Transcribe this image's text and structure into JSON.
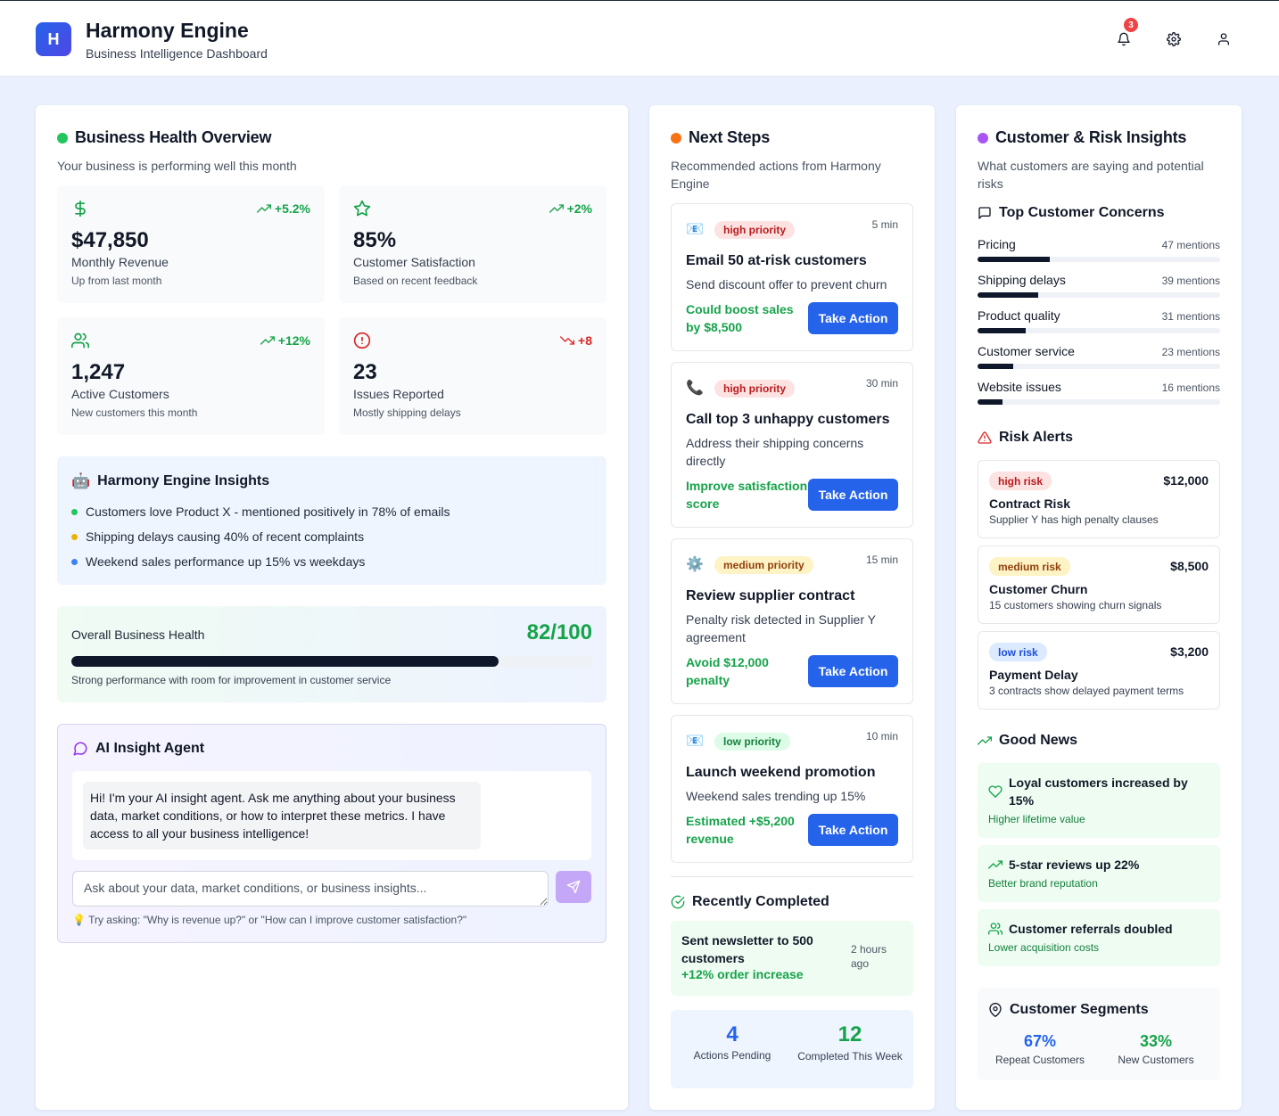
{
  "header": {
    "logo_letter": "H",
    "title": "Harmony Engine",
    "subtitle": "Business Intelligence Dashboard",
    "notification_count": "3",
    "icons": [
      "bell-icon",
      "gear-icon",
      "user-icon"
    ]
  },
  "health_overview": {
    "title": "Business Health Overview",
    "subtitle": "Your business is performing well this month",
    "metrics": [
      {
        "icon": "dollar-icon",
        "change": "+5.2%",
        "trend": "up",
        "value": "$47,850",
        "label": "Monthly Revenue",
        "note": "Up from last month"
      },
      {
        "icon": "star-icon",
        "change": "+2%",
        "trend": "up",
        "value": "85%",
        "label": "Customer Satisfaction",
        "note": "Based on recent feedback"
      },
      {
        "icon": "users-icon",
        "change": "+12%",
        "trend": "up",
        "value": "1,247",
        "label": "Active Customers",
        "note": "New customers this month"
      },
      {
        "icon": "alert-circle-icon",
        "change": "+8",
        "trend": "down",
        "value": "23",
        "label": "Issues Reported",
        "note": "Mostly shipping delays"
      }
    ],
    "insights": {
      "title": "Harmony Engine Insights",
      "items": [
        {
          "text": "Customers love Product X - mentioned positively in 78% of emails",
          "color": "#22c55e"
        },
        {
          "text": "Shipping delays causing 40% of recent complaints",
          "color": "#eab308"
        },
        {
          "text": "Weekend sales performance up 15% vs weekdays",
          "color": "#3b82f6"
        }
      ]
    },
    "overall": {
      "label": "Overall Business Health",
      "score": "82/100",
      "value": 82,
      "max": 100,
      "note": "Strong performance with room for improvement in customer service"
    },
    "agent": {
      "title": "AI Insight Agent",
      "message": "Hi! I'm your AI insight agent. Ask me anything about your business data, market conditions, or how to interpret these metrics. I have access to all your business intelligence!",
      "placeholder": "Ask about your data, market conditions, or business insights...",
      "hint": "Try asking: \"Why is revenue up?\" or \"How can I improve customer satisfaction?\""
    }
  },
  "next_steps": {
    "title": "Next Steps",
    "subtitle": "Recommended actions from Harmony Engine",
    "actions": [
      {
        "icon": "📧",
        "priority": "high priority",
        "level": "high",
        "time": "5 min",
        "title": "Email 50 at-risk customers",
        "description": "Send discount offer to prevent churn",
        "impact": "Could boost sales by $8,500",
        "button": "Take Action"
      },
      {
        "icon": "📞",
        "priority": "high priority",
        "level": "high",
        "time": "30 min",
        "title": "Call top 3 unhappy customers",
        "description": "Address their shipping concerns directly",
        "impact": "Improve satisfaction score",
        "button": "Take Action"
      },
      {
        "icon": "⚙️",
        "priority": "medium priority",
        "level": "medium",
        "time": "15 min",
        "title": "Review supplier contract",
        "description": "Penalty risk detected in Supplier Y agreement",
        "impact": "Avoid $12,000 penalty",
        "button": "Take Action"
      },
      {
        "icon": "📧",
        "priority": "low priority",
        "level": "low",
        "time": "10 min",
        "title": "Launch weekend promotion",
        "description": "Weekend sales trending up 15%",
        "impact": "Estimated +$5,200 revenue",
        "button": "Take Action"
      }
    ],
    "completed": {
      "title": "Recently Completed",
      "item": "Sent newsletter to 500 customers",
      "result": "+12% order increase",
      "time": "2 hours ago"
    },
    "stats": [
      {
        "value": "4",
        "label": "Actions Pending",
        "color": "#2563eb"
      },
      {
        "value": "12",
        "label": "Completed This Week",
        "color": "#16a34a"
      }
    ]
  },
  "customer_risk": {
    "title": "Customer & Risk Insights",
    "subtitle": "What customers are saying and potential risks",
    "concerns_title": "Top Customer Concerns",
    "concerns": [
      {
        "label": "Pricing",
        "mentions": "47 mentions",
        "count": 47
      },
      {
        "label": "Shipping delays",
        "mentions": "39 mentions",
        "count": 39
      },
      {
        "label": "Product quality",
        "mentions": "31 mentions",
        "count": 31
      },
      {
        "label": "Customer service",
        "mentions": "23 mentions",
        "count": 23
      },
      {
        "label": "Website issues",
        "mentions": "16 mentions",
        "count": 16
      }
    ],
    "risk_title": "Risk Alerts",
    "risks": [
      {
        "badge": "high risk",
        "level": "high",
        "amount": "$12,000",
        "title": "Contract Risk",
        "description": "Supplier Y has high penalty clauses"
      },
      {
        "badge": "medium risk",
        "level": "medium",
        "amount": "$8,500",
        "title": "Customer Churn",
        "description": "15 customers showing churn signals"
      },
      {
        "badge": "low risk",
        "level": "low",
        "amount": "$3,200",
        "title": "Payment Delay",
        "description": "3 contracts show delayed payment terms"
      }
    ],
    "good_title": "Good News",
    "good_news": [
      {
        "icon": "heart-icon",
        "title": "Loyal customers increased by 15%",
        "note": "Higher lifetime value"
      },
      {
        "icon": "trending-up-icon",
        "title": "5-star reviews up 22%",
        "note": "Better brand reputation"
      },
      {
        "icon": "users-icon",
        "title": "Customer referrals doubled",
        "note": "Lower acquisition costs"
      }
    ],
    "segments_title": "Customer Segments",
    "segments": [
      {
        "value": "67%",
        "label": "Repeat Customers",
        "color": "#2563eb"
      },
      {
        "value": "33%",
        "label": "New Customers",
        "color": "#16a34a"
      }
    ]
  },
  "colors": {
    "accent": "#2563eb",
    "positive": "#16a34a",
    "negative": "#dc2626",
    "dot_health": "#22c55e",
    "dot_steps": "#f97316",
    "dot_risk": "#a855f7"
  }
}
